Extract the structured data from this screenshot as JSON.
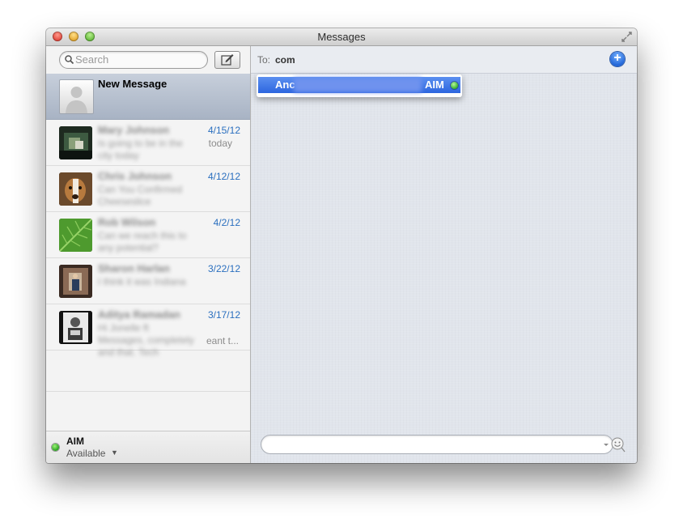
{
  "window": {
    "title": "Messages"
  },
  "sidebar": {
    "search_placeholder": "Search",
    "conversations": [
      {
        "name": "New Message",
        "date": "",
        "preview": "",
        "selected": true
      },
      {
        "name": "Mary Johnson",
        "date": "4/15/12",
        "preview": "Is going to be in the city today",
        "extra": "today"
      },
      {
        "name": "Chris Johnson",
        "date": "4/12/12",
        "preview": "Can You Confirmed Cheeseslice"
      },
      {
        "name": "Rob Wilson",
        "date": "4/2/12",
        "preview": "Can we reach this to any potential?"
      },
      {
        "name": "Sharon Harlan",
        "date": "3/22/12",
        "preview": "I think it was Indiana"
      },
      {
        "name": "Aditya Ramadan",
        "date": "3/17/12",
        "preview": "Hi Jonelle ft Messages, completely and that. Tech",
        "extra": "eant t..."
      }
    ],
    "status": {
      "service": "AIM",
      "state": "Available"
    }
  },
  "main": {
    "to_label": "To:",
    "to_value": "com",
    "suggestion": {
      "name_visible": "Anc",
      "service": "AIM"
    },
    "compose_placeholder": ""
  },
  "colors": {
    "accent_blue": "#2d66df",
    "date_blue": "#2a6fbf",
    "status_green": "#27a11c"
  }
}
